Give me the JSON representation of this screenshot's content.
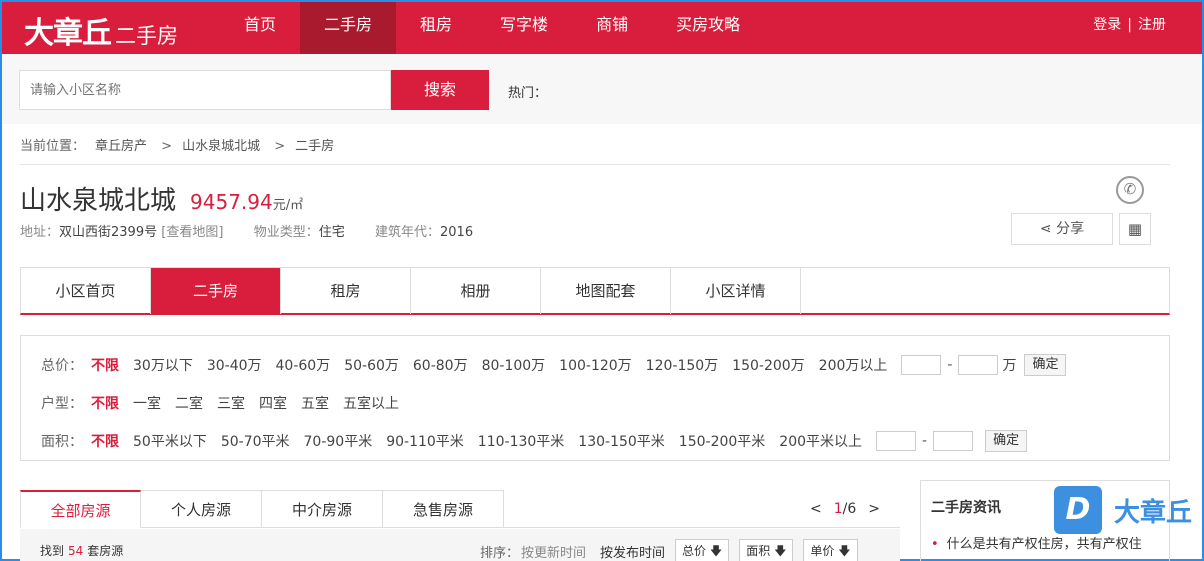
{
  "header": {
    "logo_main": "大章丘",
    "logo_sub": "二手房",
    "nav": [
      "首页",
      "二手房",
      "租房",
      "写字楼",
      "商铺",
      "买房攻略"
    ],
    "login": "登录",
    "separator": "|",
    "register": "注册"
  },
  "search": {
    "placeholder": "请输入小区名称",
    "button": "搜索",
    "hot_label": "热门："
  },
  "breadcrumb": {
    "prefix": "当前位置：",
    "items": [
      "章丘房产",
      "山水泉城北城",
      "二手房"
    ],
    "arrow": ">"
  },
  "community": {
    "name": "山水泉城北城",
    "price": "9457.94",
    "price_unit": "元/㎡",
    "address_label": "地址：",
    "address": "双山西街2399号",
    "map_link": "[查看地图]",
    "type_label": "物业类型：",
    "type": "住宅",
    "year_label": "建筑年代：",
    "year": "2016",
    "share": "分享"
  },
  "subtabs": [
    "小区首页",
    "二手房",
    "租房",
    "相册",
    "地图配套",
    "小区详情"
  ],
  "filters": {
    "price": {
      "label": "总价：",
      "options": [
        "不限",
        "30万以下",
        "30-40万",
        "40-60万",
        "50-60万",
        "60-80万",
        "80-100万",
        "100-120万",
        "120-150万",
        "150-200万",
        "200万以上"
      ],
      "dash": "-",
      "unit": "万",
      "confirm": "确定"
    },
    "layout": {
      "label": "户型：",
      "options": [
        "不限",
        "一室",
        "二室",
        "三室",
        "四室",
        "五室",
        "五室以上"
      ]
    },
    "area": {
      "label": "面积：",
      "options": [
        "不限",
        "50平米以下",
        "50-70平米",
        "70-90平米",
        "90-110平米",
        "110-130平米",
        "130-150平米",
        "150-200平米",
        "200平米以上"
      ],
      "dash": "-",
      "confirm": "确定"
    }
  },
  "listing": {
    "tabs": [
      "全部房源",
      "个人房源",
      "中介房源",
      "急售房源"
    ],
    "pager": {
      "prev": "<",
      "current": "1",
      "slash": "/",
      "total": "6",
      "next": ">"
    },
    "found_prefix": "找到",
    "found_count": "54",
    "found_suffix": "套房源",
    "sort_label": "排序：",
    "sort_options": [
      "按更新时间",
      "按发布时间"
    ],
    "sort_buttons": [
      "总价",
      "面积",
      "单价"
    ]
  },
  "sidebar": {
    "title": "二手房资讯",
    "news": [
      "什么是共有产权住房，共有产权住"
    ]
  },
  "watermark": {
    "letter": "D",
    "text": "大章丘"
  },
  "colors": {
    "brand": "#d81e3c",
    "brand_dark": "#a91a2f",
    "watermark": "#3d8fe0"
  }
}
